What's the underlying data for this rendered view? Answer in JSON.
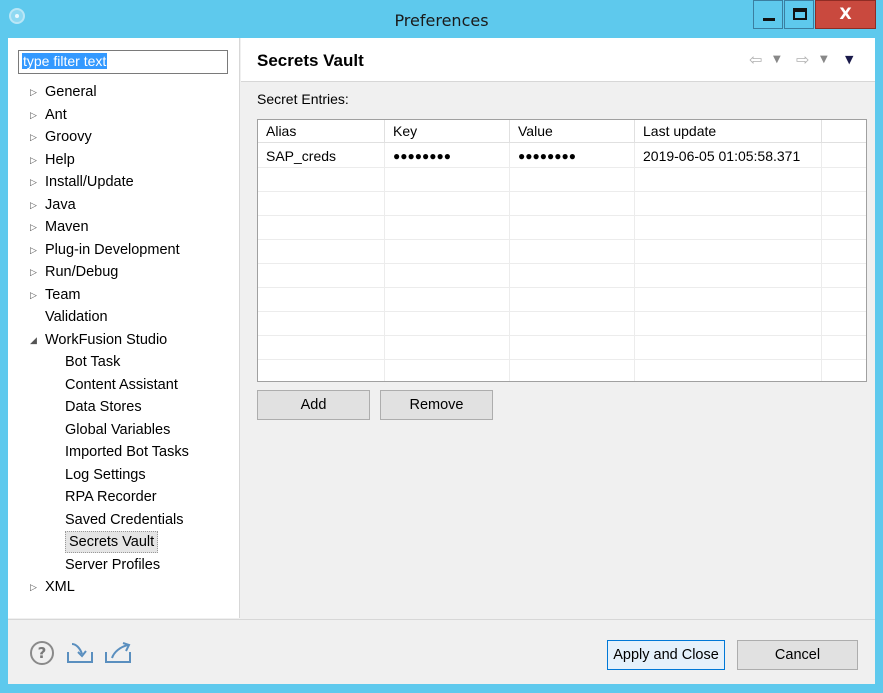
{
  "window": {
    "title": "Preferences"
  },
  "filter": {
    "value": "type filter text"
  },
  "tree": [
    {
      "label": "General",
      "expandable": true,
      "expanded": false,
      "level": 0
    },
    {
      "label": "Ant",
      "expandable": true,
      "expanded": false,
      "level": 0
    },
    {
      "label": "Groovy",
      "expandable": true,
      "expanded": false,
      "level": 0
    },
    {
      "label": "Help",
      "expandable": true,
      "expanded": false,
      "level": 0
    },
    {
      "label": "Install/Update",
      "expandable": true,
      "expanded": false,
      "level": 0
    },
    {
      "label": "Java",
      "expandable": true,
      "expanded": false,
      "level": 0
    },
    {
      "label": "Maven",
      "expandable": true,
      "expanded": false,
      "level": 0
    },
    {
      "label": "Plug-in Development",
      "expandable": true,
      "expanded": false,
      "level": 0
    },
    {
      "label": "Run/Debug",
      "expandable": true,
      "expanded": false,
      "level": 0
    },
    {
      "label": "Team",
      "expandable": true,
      "expanded": false,
      "level": 0
    },
    {
      "label": "Validation",
      "expandable": false,
      "expanded": false,
      "level": 0
    },
    {
      "label": "WorkFusion Studio",
      "expandable": true,
      "expanded": true,
      "level": 0
    },
    {
      "label": "Bot Task",
      "expandable": false,
      "expanded": false,
      "level": 1
    },
    {
      "label": "Content Assistant",
      "expandable": false,
      "expanded": false,
      "level": 1
    },
    {
      "label": "Data Stores",
      "expandable": false,
      "expanded": false,
      "level": 1
    },
    {
      "label": "Global Variables",
      "expandable": false,
      "expanded": false,
      "level": 1
    },
    {
      "label": "Imported Bot Tasks",
      "expandable": false,
      "expanded": false,
      "level": 1
    },
    {
      "label": "Log Settings",
      "expandable": false,
      "expanded": false,
      "level": 1
    },
    {
      "label": "RPA Recorder",
      "expandable": false,
      "expanded": false,
      "level": 1
    },
    {
      "label": "Saved Credentials",
      "expandable": false,
      "expanded": false,
      "level": 1
    },
    {
      "label": "Secrets Vault",
      "expandable": false,
      "expanded": false,
      "level": 1,
      "selected": true
    },
    {
      "label": "Server Profiles",
      "expandable": false,
      "expanded": false,
      "level": 1
    },
    {
      "label": "XML",
      "expandable": true,
      "expanded": false,
      "level": 0
    }
  ],
  "page": {
    "title": "Secrets Vault",
    "entries_label": "Secret Entries:"
  },
  "table": {
    "columns": [
      "Alias",
      "Key",
      "Value",
      "Last update"
    ],
    "rows": [
      [
        "SAP_creds",
        "●●●●●●●●",
        "●●●●●●●●",
        "2019-06-05 01:05:58.371"
      ]
    ]
  },
  "buttons": {
    "add": "Add",
    "remove": "Remove",
    "apply_close": "Apply and Close",
    "cancel": "Cancel",
    "minimize_glyph": "",
    "close_glyph": "X"
  },
  "icons": {
    "nav_back": "⇦",
    "nav_forward": "⇨",
    "dropdown": "▼",
    "help": "?"
  },
  "colors": {
    "title_bar": "#5ec9ed",
    "close_button": "#c9493e",
    "selection": "#3399ff",
    "default_button_border": "#0078d7"
  }
}
